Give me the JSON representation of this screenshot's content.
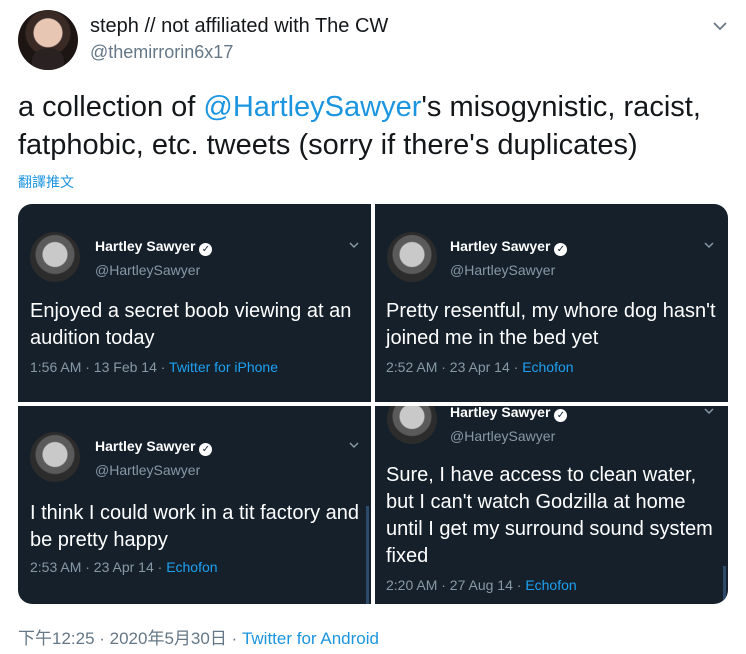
{
  "header": {
    "display_name": "steph // not affiliated with The CW",
    "handle": "@themirrorin6x17",
    "caret_icon": "chevron-down-icon"
  },
  "tweet": {
    "text_before": "a collection of ",
    "mention": "@HartleySawyer",
    "text_after": "'s misogynistic, racist, fatphobic, etc. tweets (sorry if there's duplicates)",
    "translate_label": "翻譯推文"
  },
  "media": {
    "cells": [
      {
        "name": "Hartley Sawyer",
        "handle": "@HartleySawyer",
        "text": "Enjoyed a secret boob viewing at an audition today",
        "time": "1:56 AM · 13 Feb 14 · ",
        "source": "Twitter for iPhone"
      },
      {
        "name": "Hartley Sawyer",
        "handle": "@HartleySawyer",
        "text": "Pretty resentful, my whore dog hasn't joined me in the bed yet",
        "time": "2:52 AM · 23 Apr 14 · ",
        "source": "Echofon"
      },
      {
        "name": "Hartley Sawyer",
        "handle": "@HartleySawyer",
        "text": "I think I could work in a tit factory and be pretty happy",
        "time": "2:53 AM · 23 Apr 14 · ",
        "source": "Echofon"
      },
      {
        "name": "Hartley Sawyer",
        "handle": "@HartleySawyer",
        "text": "Sure, I have access to clean water, but I can't watch Godzilla at home until I get my surround sound system fixed",
        "time": "2:20 AM · 27 Aug 14 · ",
        "source": "Echofon"
      }
    ]
  },
  "footer": {
    "timestamp": "下午12:25 · 2020年5月30日 · ",
    "source": "Twitter for Android"
  },
  "colors": {
    "link": "#1b95e0",
    "dark_bg": "#15202b",
    "muted": "#657786"
  }
}
